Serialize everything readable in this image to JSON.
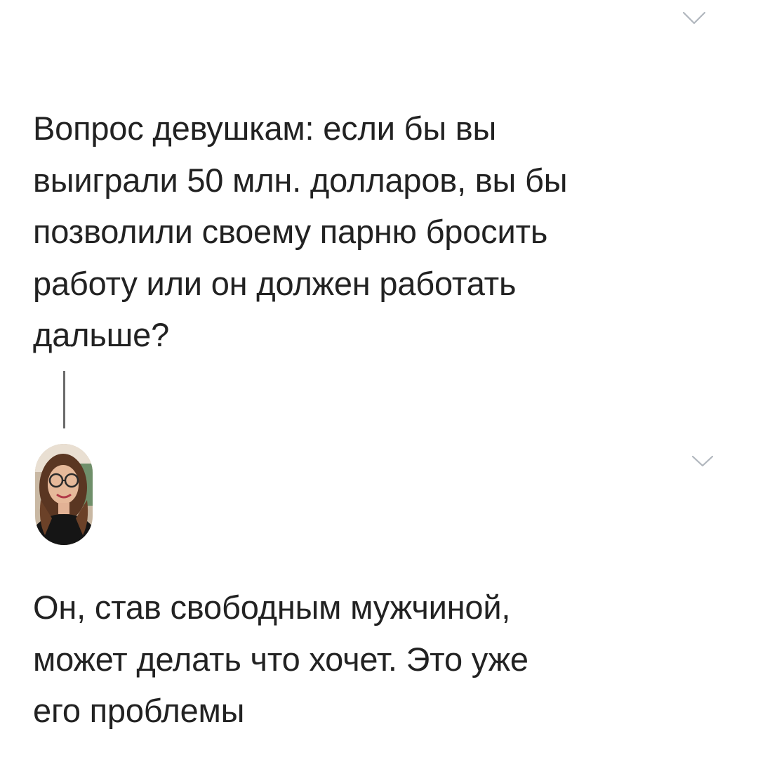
{
  "tweets": [
    {
      "text": "Вопрос девушкам: если бы вы\nвыиграли 50 млн. долларов, вы бы\nпозволили своему парню бросить\nработу или он должен работать\nдальше?",
      "menu_icon": "chevron-down-icon"
    },
    {
      "text": "Он, став свободным мужчиной,\nможет делать что хочет. Это уже\nего проблемы",
      "menu_icon": "chevron-down-icon",
      "avatar": "avatar"
    }
  ],
  "colors": {
    "background": "#ffffff",
    "text": "#222222",
    "chevron": "#b0b6bd",
    "thread_line": "#6b6b6b"
  }
}
